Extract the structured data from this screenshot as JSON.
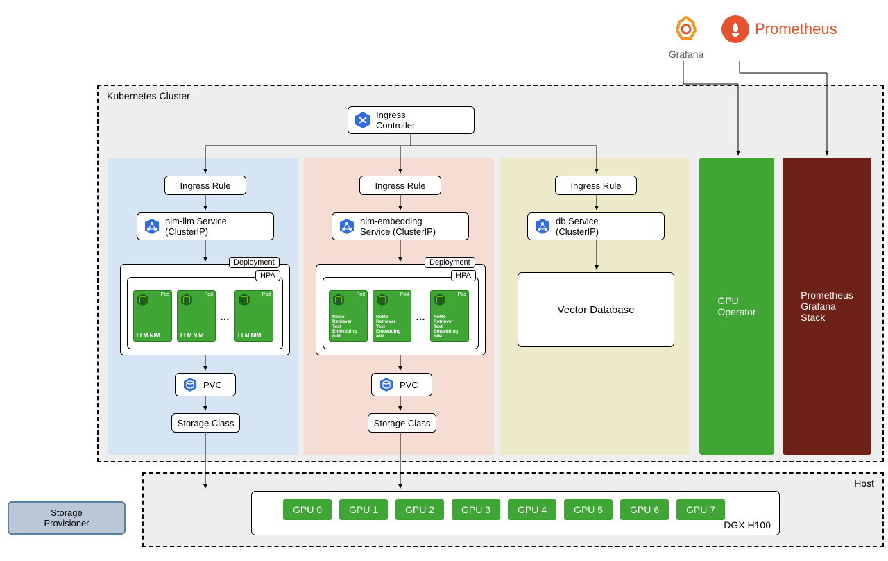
{
  "logos": {
    "grafana": "Grafana",
    "prometheus": "Prometheus"
  },
  "cluster": {
    "title": "Kubernetes Cluster"
  },
  "ingress_controller": "Ingress\nController",
  "columns": {
    "blue": {
      "ingress_rule": "Ingress Rule",
      "service": "nim-llm Service\n(ClusterIP)",
      "deployment": "Deployment",
      "hpa": "HPA",
      "pod_label": "LLM NIM",
      "pod_tag": "Pod",
      "pvc": "PVC",
      "storage_class": "Storage Class"
    },
    "red": {
      "ingress_rule": "Ingress Rule",
      "service": "nim-embedding\nService (ClusterIP)",
      "deployment": "Deployment",
      "hpa": "HPA",
      "pod_label": "NeMo Retriever\nText Embedding\nNIM",
      "pod_tag": "Pod",
      "pvc": "PVC",
      "storage_class": "Storage Class"
    },
    "yellow": {
      "ingress_rule": "Ingress Rule",
      "service": "db Service\n(ClusterIP)",
      "vector_db": "Vector Database"
    },
    "green_text": "GPU\nOperator",
    "brown_text": "Prometheus\nGrafana\nStack"
  },
  "host": {
    "title": "Host",
    "dgx": "DGX H100",
    "gpus": [
      "GPU 0",
      "GPU 1",
      "GPU 2",
      "GPU 3",
      "GPU 4",
      "GPU 5",
      "GPU 6",
      "GPU 7"
    ]
  },
  "storage_provisioner": "Storage\nProvisioner"
}
